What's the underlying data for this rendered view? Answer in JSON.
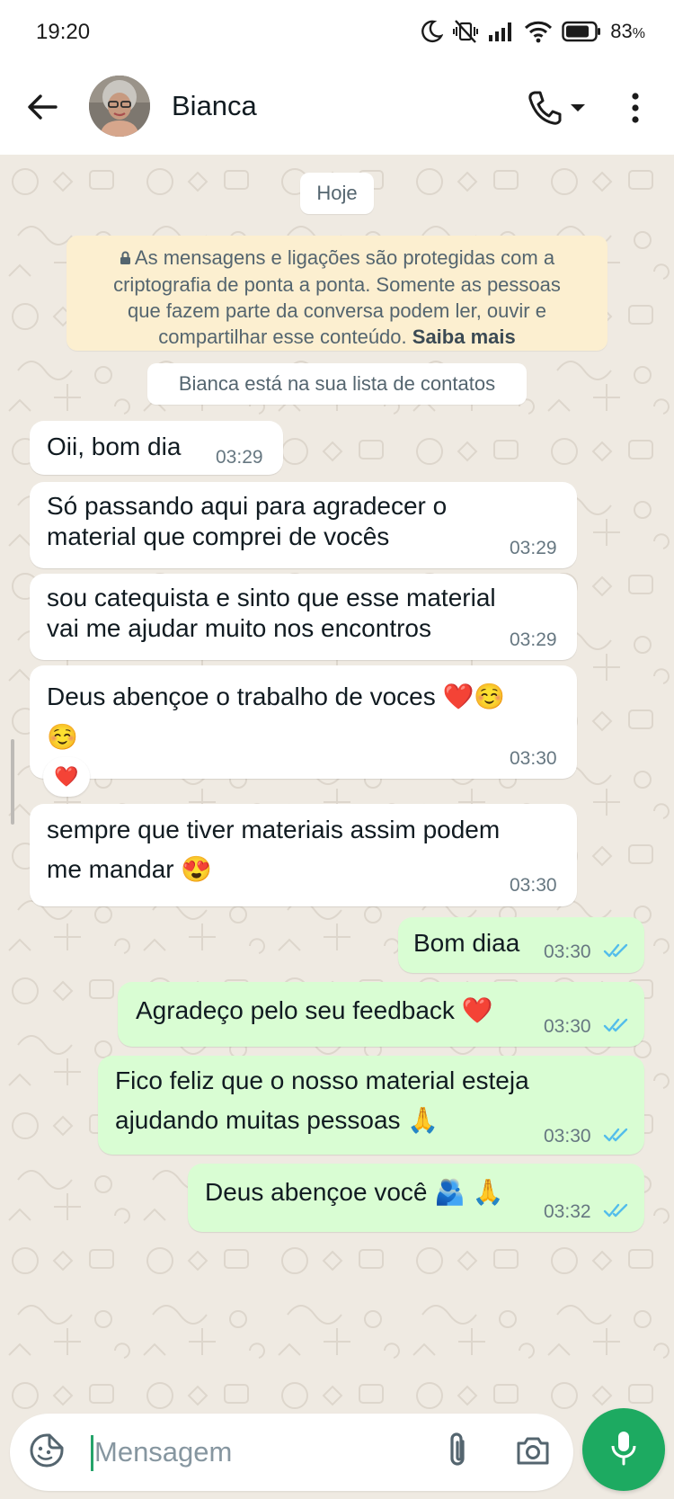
{
  "status_bar": {
    "time": "19:20",
    "battery_text": "83",
    "battery_unit": "%",
    "icons": [
      "moon-icon",
      "vibrate-off-icon",
      "signal-icon",
      "wifi-icon",
      "battery-icon"
    ]
  },
  "header": {
    "contact_name": "Bianca",
    "icons": [
      "back-arrow-icon",
      "phone-icon",
      "dropdown-arrow-icon",
      "more-vert-icon"
    ]
  },
  "chat": {
    "date_chip": "Hoje",
    "encryption_notice": {
      "lines": [
        "As mensagens e ligações são protegidas com a",
        "criptografia de ponta a ponta. Somente as pessoas",
        "que fazem parte da conversa podem ler, ouvir e",
        "compartilhar esse conteúdo."
      ],
      "link": "Saiba mais"
    },
    "contact_notice": "Bianca está na sua lista de contatos",
    "messages": [
      {
        "direction": "incoming",
        "lines": [
          "Oii, bom dia"
        ],
        "time": "03:29"
      },
      {
        "direction": "incoming",
        "lines": [
          "Só passando aqui para agradecer o",
          "material que comprei de vocês"
        ],
        "time": "03:29"
      },
      {
        "direction": "incoming",
        "lines": [
          "sou catequista e sinto que esse material",
          "vai me ajudar muito nos encontros"
        ],
        "time": "03:29"
      },
      {
        "direction": "incoming",
        "lines": [
          "Deus abençoe o trabalho de voces ❤️☺️",
          "☺️"
        ],
        "time": "03:30",
        "reaction": "❤️"
      },
      {
        "direction": "incoming",
        "lines": [
          "sempre que tiver materiais assim podem",
          "me mandar 😍"
        ],
        "time": "03:30"
      },
      {
        "direction": "outgoing",
        "lines": [
          "Bom diaa"
        ],
        "time": "03:30",
        "status": "read"
      },
      {
        "direction": "outgoing",
        "lines": [
          "Agradeço pelo seu feedback ❤️"
        ],
        "time": "03:30",
        "status": "read"
      },
      {
        "direction": "outgoing",
        "lines": [
          "Fico feliz que o nosso material esteja",
          "ajudando muitas pessoas 🙏"
        ],
        "time": "03:30",
        "status": "read"
      },
      {
        "direction": "outgoing",
        "lines": [
          "Deus abençoe você 🫂 🙏"
        ],
        "time": "03:32",
        "status": "read"
      }
    ]
  },
  "composer": {
    "placeholder": "Mensagem",
    "icons": [
      "sticker-icon",
      "paperclip-icon",
      "camera-icon",
      "microphone-icon"
    ]
  },
  "colors": {
    "chat_background": "#efeae2",
    "incoming_bubble": "#ffffff",
    "outgoing_bubble": "#d9fdd3",
    "encryption_notice_bg": "#fcefd0",
    "read_ticks": "#53bdeb",
    "mic_button": "#1daa61"
  }
}
